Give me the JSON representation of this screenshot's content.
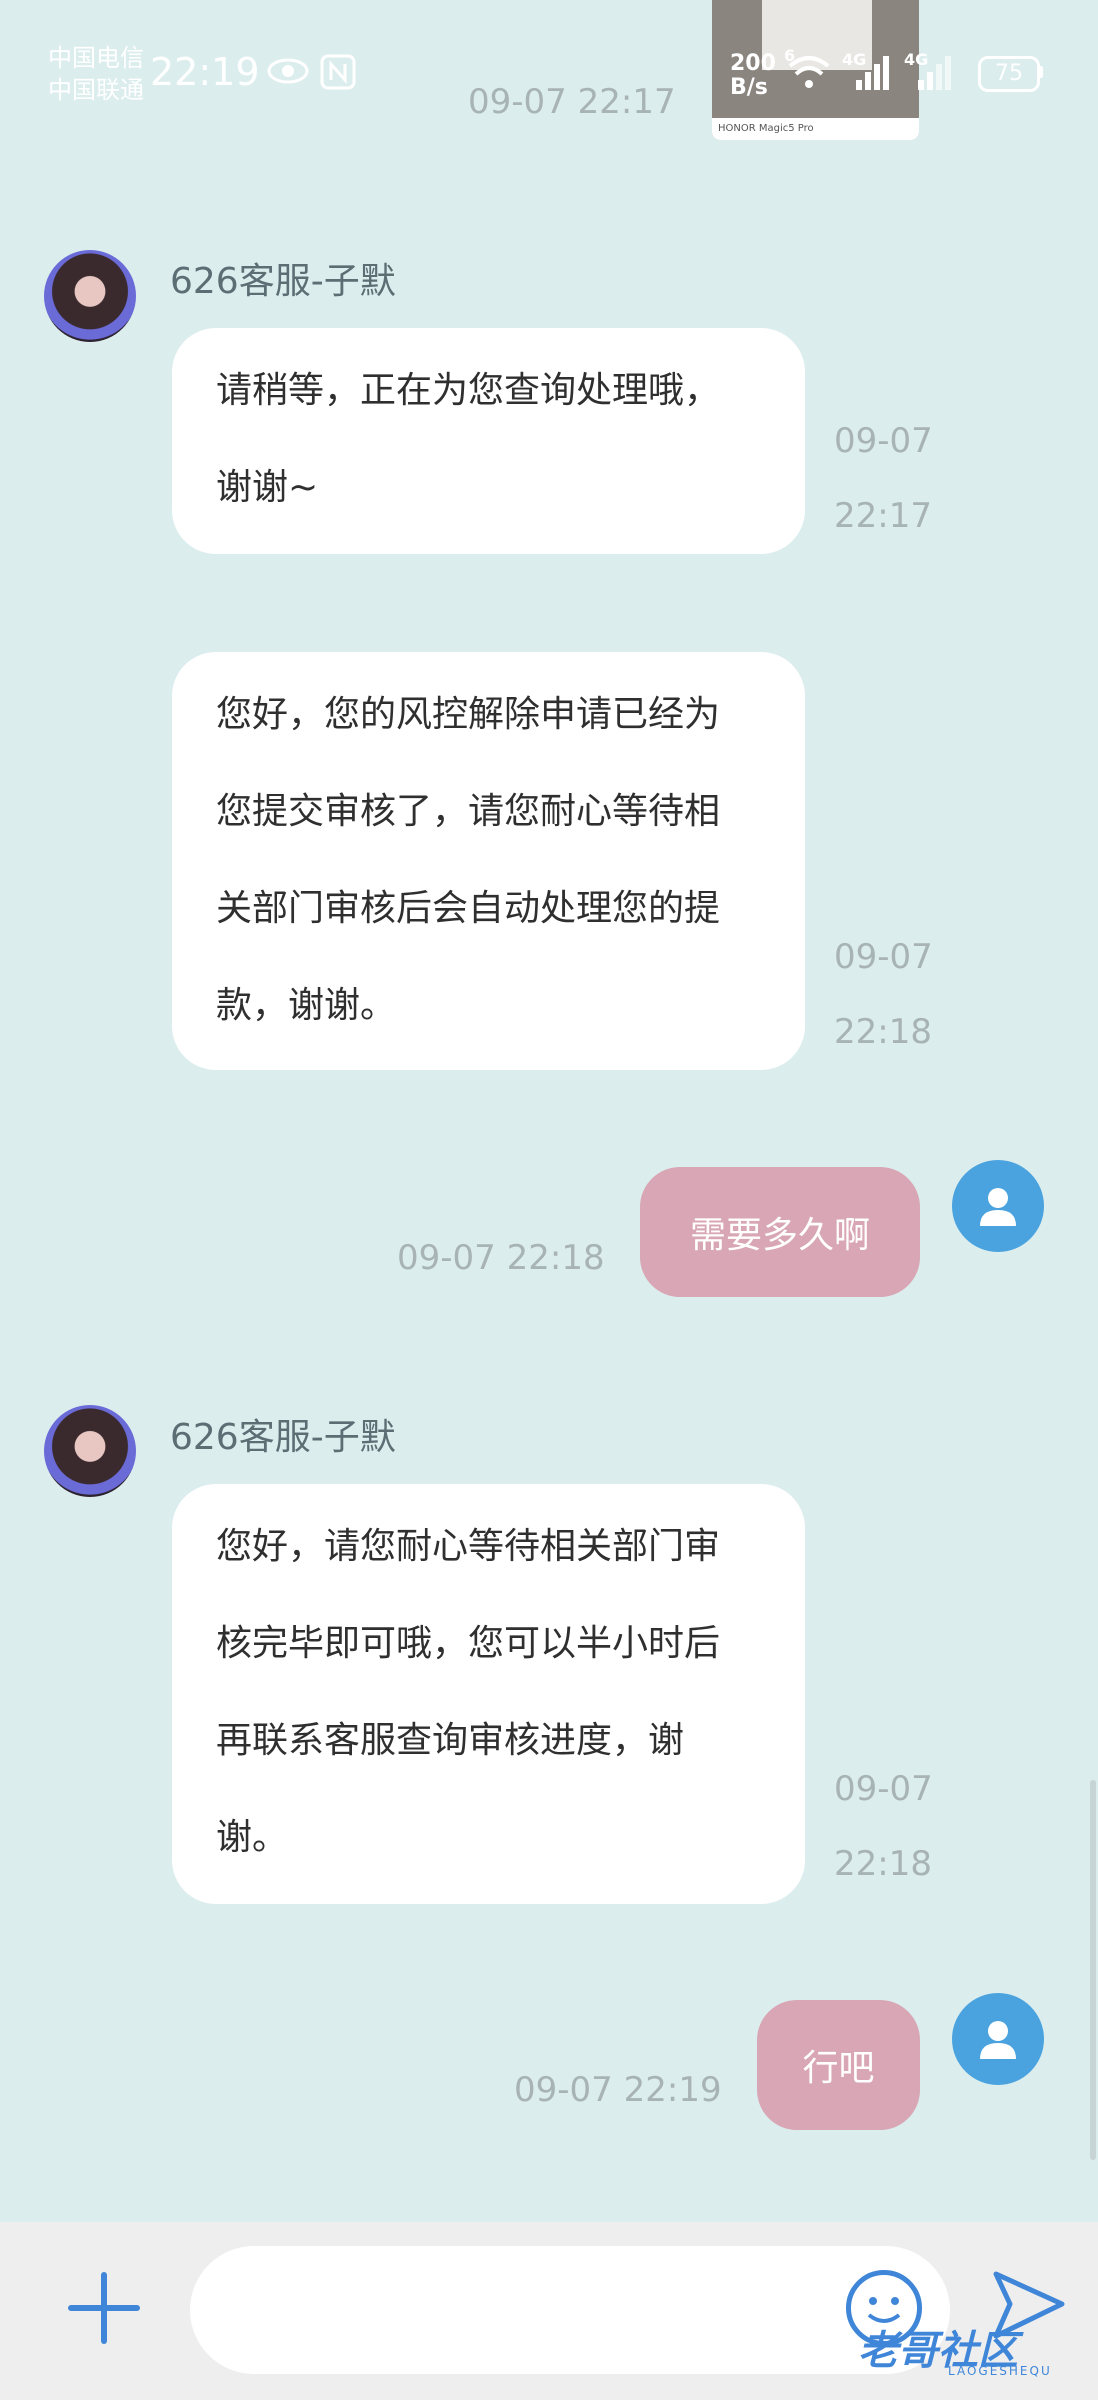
{
  "status_bar": {
    "carrier_1": "中国电信",
    "carrier_2": "中国联通",
    "time": "22:19",
    "net_speed_value": "200",
    "net_speed_unit": "B/s",
    "signal_label_1": "4G",
    "signal_label_2": "4G",
    "wifi_label": "6",
    "battery": "75"
  },
  "top_image": {
    "caption": "HONOR Magic5 Pro",
    "timestamp": "09-07 22:17"
  },
  "messages": [
    {
      "sender": "626客服-子默",
      "lines": [
        "请稍等，正在为您查询处理哦，",
        "谢谢~"
      ],
      "date": "09-07",
      "time": "22:17"
    },
    {
      "lines": [
        "您好，您的风控解除申请已经为",
        "您提交审核了，请您耐心等待相",
        "关部门审核后会自动处理您的提",
        "款，谢谢。"
      ],
      "date": "09-07",
      "time": "22:18"
    },
    {
      "text": "需要多久啊",
      "timestamp": "09-07 22:18"
    },
    {
      "sender": "626客服-子默",
      "lines": [
        "您好，请您耐心等待相关部门审",
        "核完毕即可哦，您可以半小时后",
        "再联系客服查询审核进度，谢",
        "谢。"
      ],
      "date": "09-07",
      "time": "22:18"
    },
    {
      "text": "行吧",
      "timestamp": "09-07 22:19"
    }
  ],
  "input_bar": {
    "placeholder": ""
  },
  "watermark": {
    "text": "老哥社区",
    "sub": "LAOGESHEQU"
  },
  "colors": {
    "background": "#dcedee",
    "outgoing_bubble": "#d8a6b5",
    "incoming_bubble": "#ffffff",
    "accent": "#3f86d9"
  }
}
